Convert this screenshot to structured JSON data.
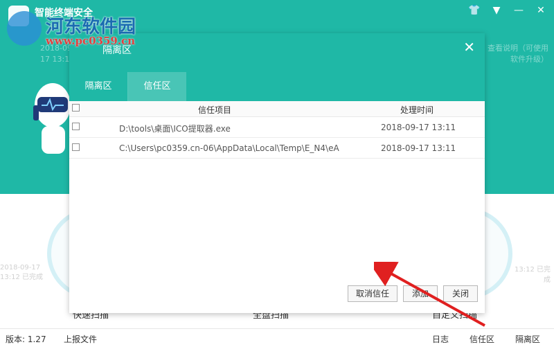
{
  "app": {
    "title": "智能终端安全",
    "side_text_left": "2018-09-17 13:12",
    "side_text_right": "查看说明（可使用软件升级）",
    "scans": [
      {
        "label": "快速扫描"
      },
      {
        "label": "全盘扫描"
      },
      {
        "label": "自定义扫描"
      }
    ],
    "left_time": "2018-09-17 13:12 已完成",
    "right_time": "13:12 已完成",
    "status_bar": {
      "version": "版本: 1.27",
      "report": "上报文件",
      "links": [
        "日志",
        "信任区",
        "隔离区"
      ]
    },
    "controls": [
      "shirt-icon",
      "menu-icon",
      "minimize-icon",
      "close-icon"
    ]
  },
  "watermark": {
    "name": "河东软件园",
    "url": "www.pc0359.cn"
  },
  "dialog": {
    "title": "隔离区",
    "tabs": [
      {
        "label": "隔离区",
        "active": false
      },
      {
        "label": "信任区",
        "active": true
      }
    ],
    "table": {
      "headers": {
        "item": "信任项目",
        "time": "处理时间"
      },
      "rows": [
        {
          "path": "D:\\tools\\桌面\\ICO提取器.exe",
          "time": "2018-09-17 13:11"
        },
        {
          "path": "C:\\Users\\pc0359.cn-06\\AppData\\Local\\Temp\\E_N4\\eA",
          "time": "2018-09-17 13:11"
        }
      ]
    },
    "buttons": {
      "cancel_trust": "取消信任",
      "add": "添加",
      "close": "关闭"
    }
  },
  "colors": {
    "teal": "#1fb8a6",
    "active_tab": "#49c5b6",
    "arrow": "#e02020"
  }
}
